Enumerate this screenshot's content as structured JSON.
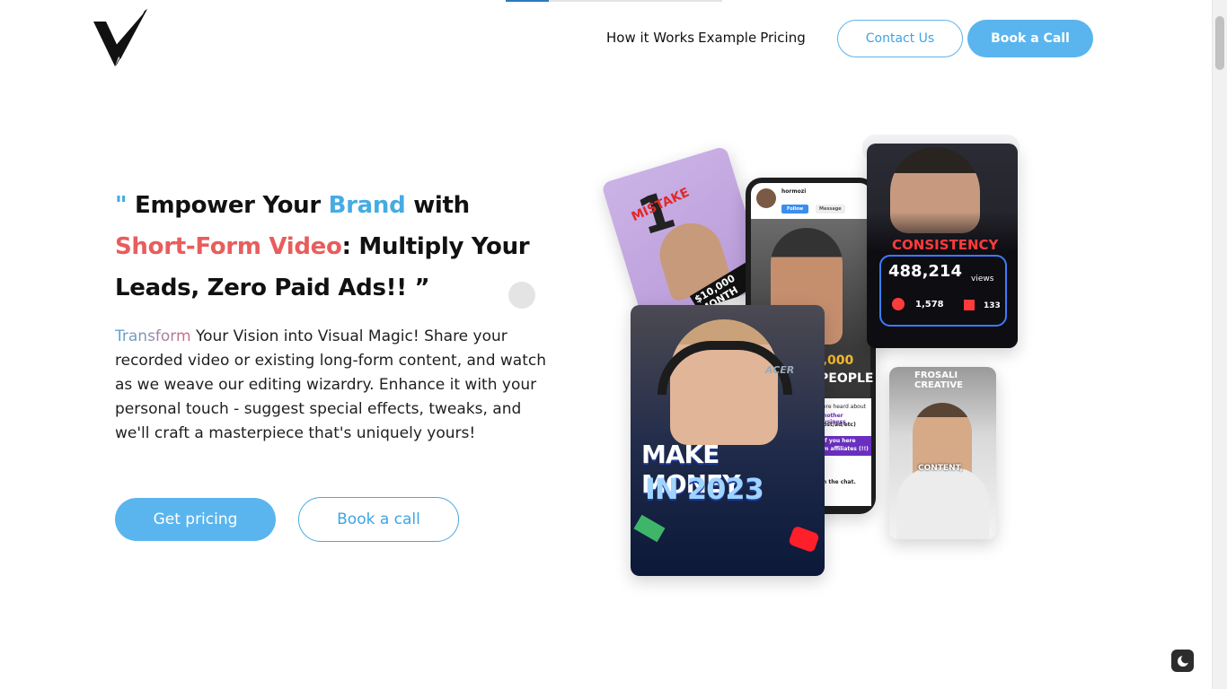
{
  "page": {
    "scroll_progress": 0.2
  },
  "logo": {
    "icon": "v-brand-logo-icon"
  },
  "nav": {
    "items": [
      {
        "label": "How it Works"
      },
      {
        "label": "Example"
      },
      {
        "label": "Pricing"
      }
    ],
    "contact_label": "Contact Us",
    "book_call_label": "Book a Call"
  },
  "hero": {
    "title": {
      "open_quote": "\" ",
      "part1": "Empower Your ",
      "brand": "Brand",
      "part2": " with ",
      "short_form": "Short-Form Video",
      "part3": ": Multiply Your Leads, Zero Paid Ads!! ”"
    },
    "description_highlight": "Transform",
    "description": " Your Vision into Visual Magic! Share your recorded video or existing long-form content, and watch as we weave our editing wizardry. Enhance it with your personal touch - suggest special effects, tweaks, and we'll craft a masterpiece that's uniquely yours!",
    "get_pricing_label": "Get pricing",
    "book_call_label": "Book a call"
  },
  "collage": {
    "mistake_card": {
      "headline": "MISTAKE",
      "number": "1",
      "caption": "$10,000 MONTH"
    },
    "phone_card": {
      "handle": "hormozi",
      "follow_label": "Follow",
      "message_label": "Message",
      "count": "4,000",
      "word": "PEOPLE",
      "lines": [
        "here heard about",
        "another business",
        "post/ad/etc)",
        "of you here",
        "om affiliates (!!)",
        "in the chat."
      ]
    },
    "consistency_card": {
      "headline": "CONSISTENCY",
      "views": "488,214",
      "views_label": "views",
      "likes": "1,578",
      "comments": "133"
    },
    "money_card": {
      "headline_line1": "MAKE MONEY",
      "headline_line2": "IN 2023",
      "brand_text": "ACER"
    },
    "frosali_card": {
      "brand": "FROSALI CREATIVE",
      "caption": "CONTENT,"
    }
  },
  "colors": {
    "accent_blue": "#5ab5ee",
    "accent_red": "#e85d5d",
    "text_dark": "#111111"
  },
  "theme_toggle": {
    "icon": "moon-icon"
  }
}
